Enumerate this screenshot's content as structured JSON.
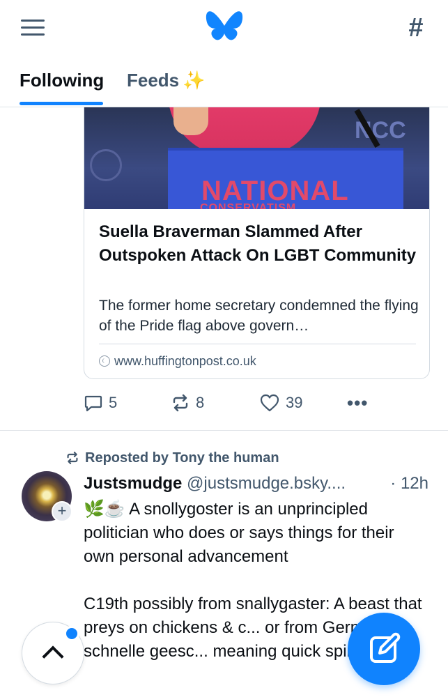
{
  "header": {
    "menu_icon": "hamburger-icon",
    "logo_icon": "butterfly-logo",
    "feeds_icon": "hashtag-icon"
  },
  "tabs": [
    {
      "label": "Following",
      "active": true
    },
    {
      "label": "Feeds",
      "active": false,
      "emoji": "✨"
    }
  ],
  "colors": {
    "accent": "#1083fe",
    "muted": "#42576c",
    "text": "#0b0f14"
  },
  "link_card": {
    "image_text": "NATIONAL",
    "image_subtext": "CONSERVATISM",
    "image_corner": "NCC",
    "title": "Suella Braverman Slammed After Outspoken Attack On LGBT Community",
    "description": "The former home secretary condemned the flying of the Pride flag above govern…",
    "domain": "www.huffingtonpost.co.uk"
  },
  "actions": {
    "reply_count": "5",
    "repost_count": "8",
    "like_count": "39",
    "more": "•••"
  },
  "post": {
    "reposted_by": "Reposted by Tony the human",
    "display_name": "Justsmudge",
    "handle": "@justsmudge.bsky....",
    "time": "· 12h",
    "line1": "🌿☕ A snollygoster is an unprincipled politician who does or says things for their own personal advancement",
    "line2": "C19th possibly from snallygaster: A beast that preys on chickens & c... or from German, schnelle geesc... meaning quick spirit"
  },
  "fab": {
    "scroll_icon": "chevron-up-icon",
    "compose_icon": "compose-icon"
  }
}
